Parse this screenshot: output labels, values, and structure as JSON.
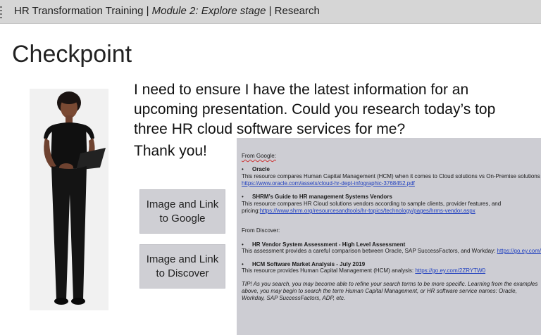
{
  "header": {
    "title_prefix": "HR Transformation Training |",
    "module": "Module 2: Explore stage",
    "section": "| Research"
  },
  "slide": {
    "title": "Checkpoint",
    "message": "I need to ensure I have the latest information for an upcoming presentation.  Could you research today’s top three HR cloud software services for me?",
    "thanks": "Thank you!"
  },
  "buttons": {
    "google": "Image and Link to Google",
    "discover": "Image and Link to Discover"
  },
  "research": {
    "from_google": "From Google:",
    "g1_title": "Oracle",
    "g1_desc": "This resource compares Human Capital Management (HCM) when it comes to Cloud solutions vs On-Premise solutions",
    "g1_url": "https://www.oracle.com/assets/cloud-hr-dept-infographic-3768452.pdf",
    "g2_title": "SHRM’s Guide to HR management Systems Vendors",
    "g2_desc": "This resource compares HR Cloud solutions vendors according to sample clients, provider features, and",
    "g2_prefix": "pricing:",
    "g2_url": "https://www.shrm.org/resourcesandtools/hr-topics/technology/pages/hrms-vendor.aspx",
    "from_discover": "From Discover:",
    "d1_title": "HR Vendor System Assessment - High Level Assessment",
    "d1_desc": "This assessment provides a careful comparison between Oracle, SAP SuccessFactors, and Workday:",
    "d1_url": "https://go.ey.com/",
    "d2_title": "HCM Software Market Analysis - July 2019",
    "d2_desc": "This resource provides Human Capital Management (HCM) analysis:",
    "d2_url": "https://go.ey.com/2ZRYTW0",
    "tip": "TIP! As you search, you may become able to refine your search terms to be more specific. Learning from the examples above, you may begin to search the term Human Capital Management, or  HR software service names: Oracle, Workday, SAP SuccessFactors, ADP, etc."
  }
}
